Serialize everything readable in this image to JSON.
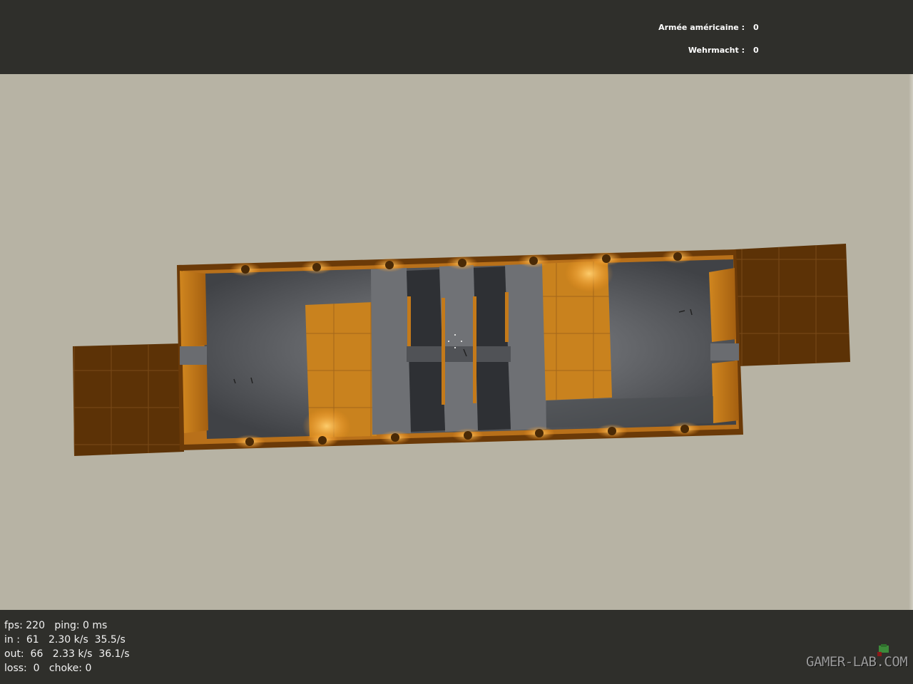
{
  "scoreboard": {
    "teams": [
      {
        "name": "Armée américaine :",
        "score": "0"
      },
      {
        "name": "Wehrmacht :",
        "score": "0"
      }
    ]
  },
  "netgraph": {
    "line1": "fps: 220   ping: 0 ms",
    "line2": "in :  61   2.30 k/s  35.5/s",
    "line3": "out:  66   2.33 k/s  36.1/s",
    "line4": "loss:  0   choke: 0"
  },
  "watermark": "GAMER-LAB.COM",
  "colors": {
    "hud_bg": "#2f2f2b",
    "void": "#b7b3a4",
    "wall_orange": "#c47a1a",
    "wall_dark": "#5a3108",
    "floor": "#585a5e"
  }
}
